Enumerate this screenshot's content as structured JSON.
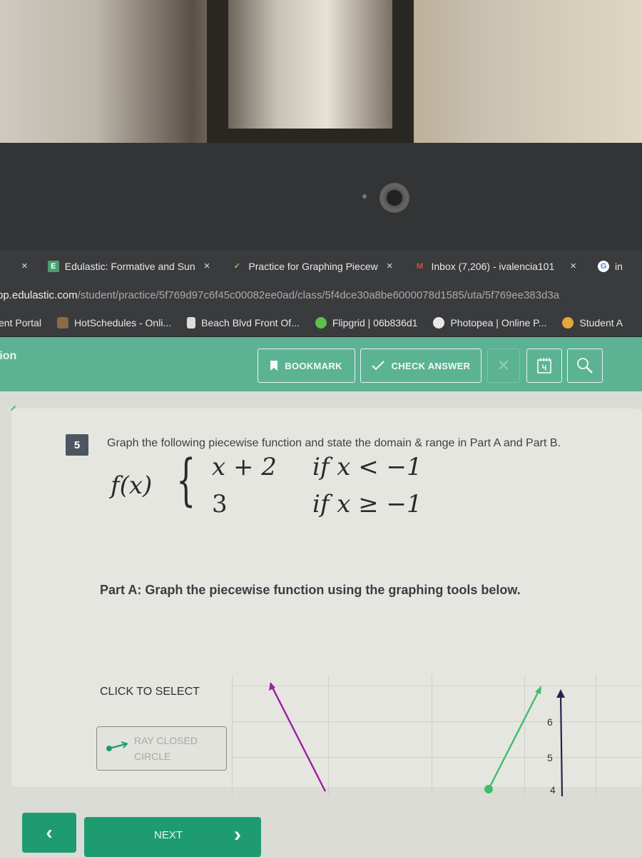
{
  "browser": {
    "tabs": [
      {
        "label": "",
        "close": "×",
        "favicon": "none"
      },
      {
        "label": "Edulastic: Formative and Sun",
        "close": "×",
        "favicon": "E"
      },
      {
        "label": "Practice for Graphing Piecew",
        "close": "×",
        "favicon": "check"
      },
      {
        "label": "Inbox (7,206) - ivalencia101",
        "close": "×",
        "favicon": "M"
      },
      {
        "label": "in",
        "close": "",
        "favicon": "G"
      }
    ],
    "url_domain": "pp.edulastic.com",
    "url_path": "/student/practice/5f769d97c6f45c00082ee0ad/class/5f4dce30a8be6000078d1585/uta/5f769ee383d3a",
    "bookmarks": [
      {
        "label": "ent Portal",
        "color": ""
      },
      {
        "label": "HotSchedules - Onli...",
        "color": "#8a6a4a"
      },
      {
        "label": "Beach Blvd Front Of...",
        "color": "#dcdcdc"
      },
      {
        "label": "Flipgrid | 06b836d1",
        "color": "#5cc04a"
      },
      {
        "label": "Photopea | Online P...",
        "color": "#e8e8e8"
      },
      {
        "label": "Student A",
        "color": "#e6a63a"
      }
    ]
  },
  "toolbar": {
    "title_fragment": "tion",
    "bookmark_label": "BOOKMARK",
    "check_answer_label": "CHECK ANSWER",
    "close_label": "✕",
    "scratchpad_icon": "notepad-icon",
    "zoom_icon": "magnifier-icon"
  },
  "question": {
    "number": "5",
    "prompt": "Graph the following piecewise function and state the domain & range in Part A and Part B.",
    "function_name": "f(x)",
    "pieces": [
      {
        "expression": "x + 2",
        "condition": "if x < −1"
      },
      {
        "expression": "3",
        "condition": "if x ≥ −1"
      }
    ],
    "part_a": "Part A: Graph the piecewise function using the graphing tools below."
  },
  "graph_tools": {
    "heading": "CLICK TO SELECT",
    "selected_tool_line1": "RAY CLOSED",
    "selected_tool_line2": "CIRCLE"
  },
  "graph": {
    "y_axis_labels": [
      "6",
      "5",
      "4"
    ],
    "colors": {
      "ray_1": "#9b1fa3",
      "ray_2": "#3dbd6e",
      "axis": "#23254f"
    }
  },
  "navigation": {
    "prev_label": "‹",
    "next_label": "NEXT",
    "next_chevron": "›"
  }
}
